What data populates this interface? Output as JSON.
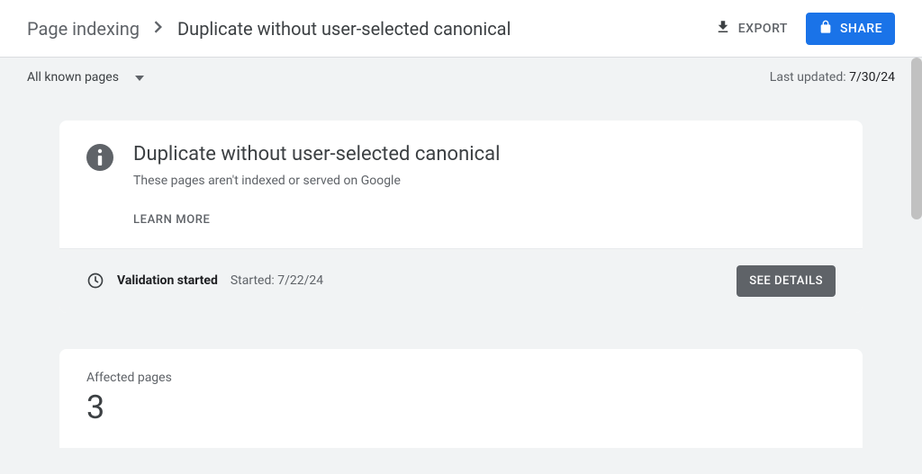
{
  "breadcrumb": {
    "root": "Page indexing",
    "current": "Duplicate without user-selected canonical"
  },
  "header": {
    "export_label": "EXPORT",
    "share_label": "SHARE"
  },
  "filter": {
    "selected": "All known pages"
  },
  "last_updated": {
    "label": "Last updated: ",
    "value": "7/30/24"
  },
  "issue_card": {
    "title": "Duplicate without user-selected canonical",
    "subtitle": "These pages aren't indexed or served on Google",
    "learn_more": "LEARN MORE"
  },
  "validation": {
    "status": "Validation started",
    "started_label": "Started: ",
    "started_date": "7/22/24",
    "see_details": "SEE DETAILS"
  },
  "affected": {
    "label": "Affected pages",
    "count": "3"
  }
}
